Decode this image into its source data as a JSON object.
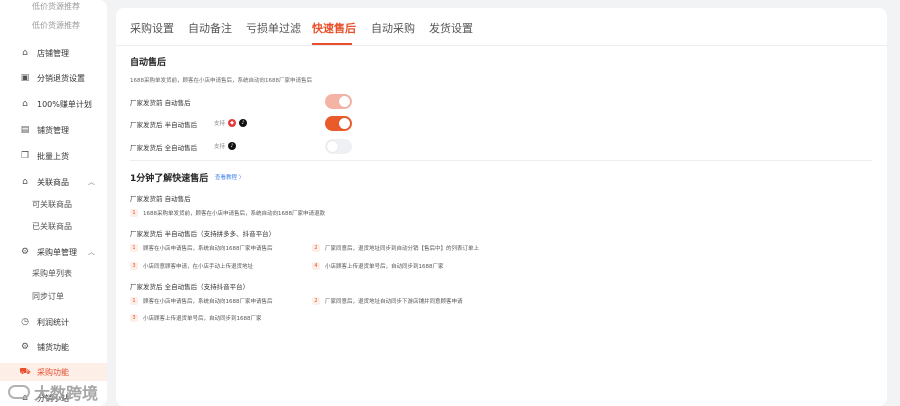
{
  "sidebar": {
    "items": [
      {
        "label": "低价货源推荐",
        "icon": "none",
        "type": "sub",
        "state": "faded"
      },
      {
        "label": "店铺管理",
        "icon": "store-icon",
        "type": "main"
      },
      {
        "label": "分销退货设置",
        "icon": "return-icon",
        "type": "main"
      },
      {
        "label": "100%赚单计划",
        "icon": "home-icon",
        "type": "main"
      },
      {
        "label": "铺货管理",
        "icon": "bag-icon",
        "type": "main"
      },
      {
        "label": "批量上货",
        "icon": "copy-icon",
        "type": "main"
      },
      {
        "label": "关联商品",
        "icon": "link-icon",
        "type": "main",
        "expanded": true
      },
      {
        "label": "可关联商品",
        "icon": "none",
        "type": "sub"
      },
      {
        "label": "已关联商品",
        "icon": "none",
        "type": "sub"
      },
      {
        "label": "采购单管理",
        "icon": "gear-icon",
        "type": "main",
        "expanded": true
      },
      {
        "label": "采购单列表",
        "icon": "none",
        "type": "sub"
      },
      {
        "label": "同步订单",
        "icon": "none",
        "type": "sub"
      },
      {
        "label": "利润统计",
        "icon": "clock-icon",
        "type": "main"
      },
      {
        "label": "铺货功能",
        "icon": "settings-icon",
        "type": "main"
      },
      {
        "label": "采购功能",
        "icon": "cart-icon",
        "type": "main",
        "active": true
      },
      {
        "label": "分销小站",
        "icon": "shop-icon",
        "type": "main"
      }
    ]
  },
  "tabs": [
    {
      "label": "采购设置"
    },
    {
      "label": "自动备注"
    },
    {
      "label": "亏损单过滤"
    },
    {
      "label": "快速售后",
      "active": true
    },
    {
      "label": "自动采购"
    },
    {
      "label": "发货设置"
    }
  ],
  "auto_after_sale": {
    "title": "自动售后",
    "desc": "1688采购单发货前，顾客在小店申请售后，系统自动向1688厂家申请售后",
    "rows": [
      {
        "label": "厂家发货前 自动售后",
        "support": "",
        "toggle_state": "on-disabled"
      },
      {
        "label": "厂家发货后 半自动售后",
        "support": "支持",
        "platforms": [
          "pdd",
          "douyin"
        ],
        "toggle_state": "on"
      },
      {
        "label": "厂家发货后 全自动售后",
        "support": "支持",
        "platforms": [
          "douyin"
        ],
        "toggle_state": "off"
      }
    ]
  },
  "guide": {
    "title": "1分钟了解快速售后",
    "link": "查看教程 〉",
    "sections": [
      {
        "heading": "厂家发货前 自动售后",
        "steps": [
          {
            "num": "1",
            "text": "1688采购单发货前，顾客在小店申请售后，系统自动向1688厂家申请退款"
          }
        ]
      },
      {
        "heading": "厂家发货后 半自动售后（支持拼多多、抖音平台）",
        "steps": [
          {
            "num": "1",
            "text": "顾客在小店申请售后，系统自动向1688厂家申请售后"
          },
          {
            "num": "2",
            "text": "厂家同意后，退货地址同步到自动分销【售后中】的列表订单上"
          },
          {
            "num": "3",
            "text": "小店同意顾客申请，在小店手动上传退货地址"
          },
          {
            "num": "4",
            "text": "小店顾客上传退货单号后，自动同步到1688厂家"
          }
        ]
      },
      {
        "heading": "厂家发货后 全自动售后（支持抖音平台）",
        "steps": [
          {
            "num": "1",
            "text": "顾客在小店申请售后，系统自动向1688厂家申请售后"
          },
          {
            "num": "2",
            "text": "厂家同意后，退货地址自动同步下游店铺并同意顾客申请"
          },
          {
            "num": "3",
            "text": "小店顾客上传退货单号后，自动同步到1688厂家"
          }
        ]
      }
    ]
  },
  "watermark": "大数跨境",
  "colors": {
    "accent": "#e8502b",
    "link": "#3c7bf0",
    "toggle_on": "#ea5b2b",
    "toggle_disabled": "#f5b3a6"
  }
}
